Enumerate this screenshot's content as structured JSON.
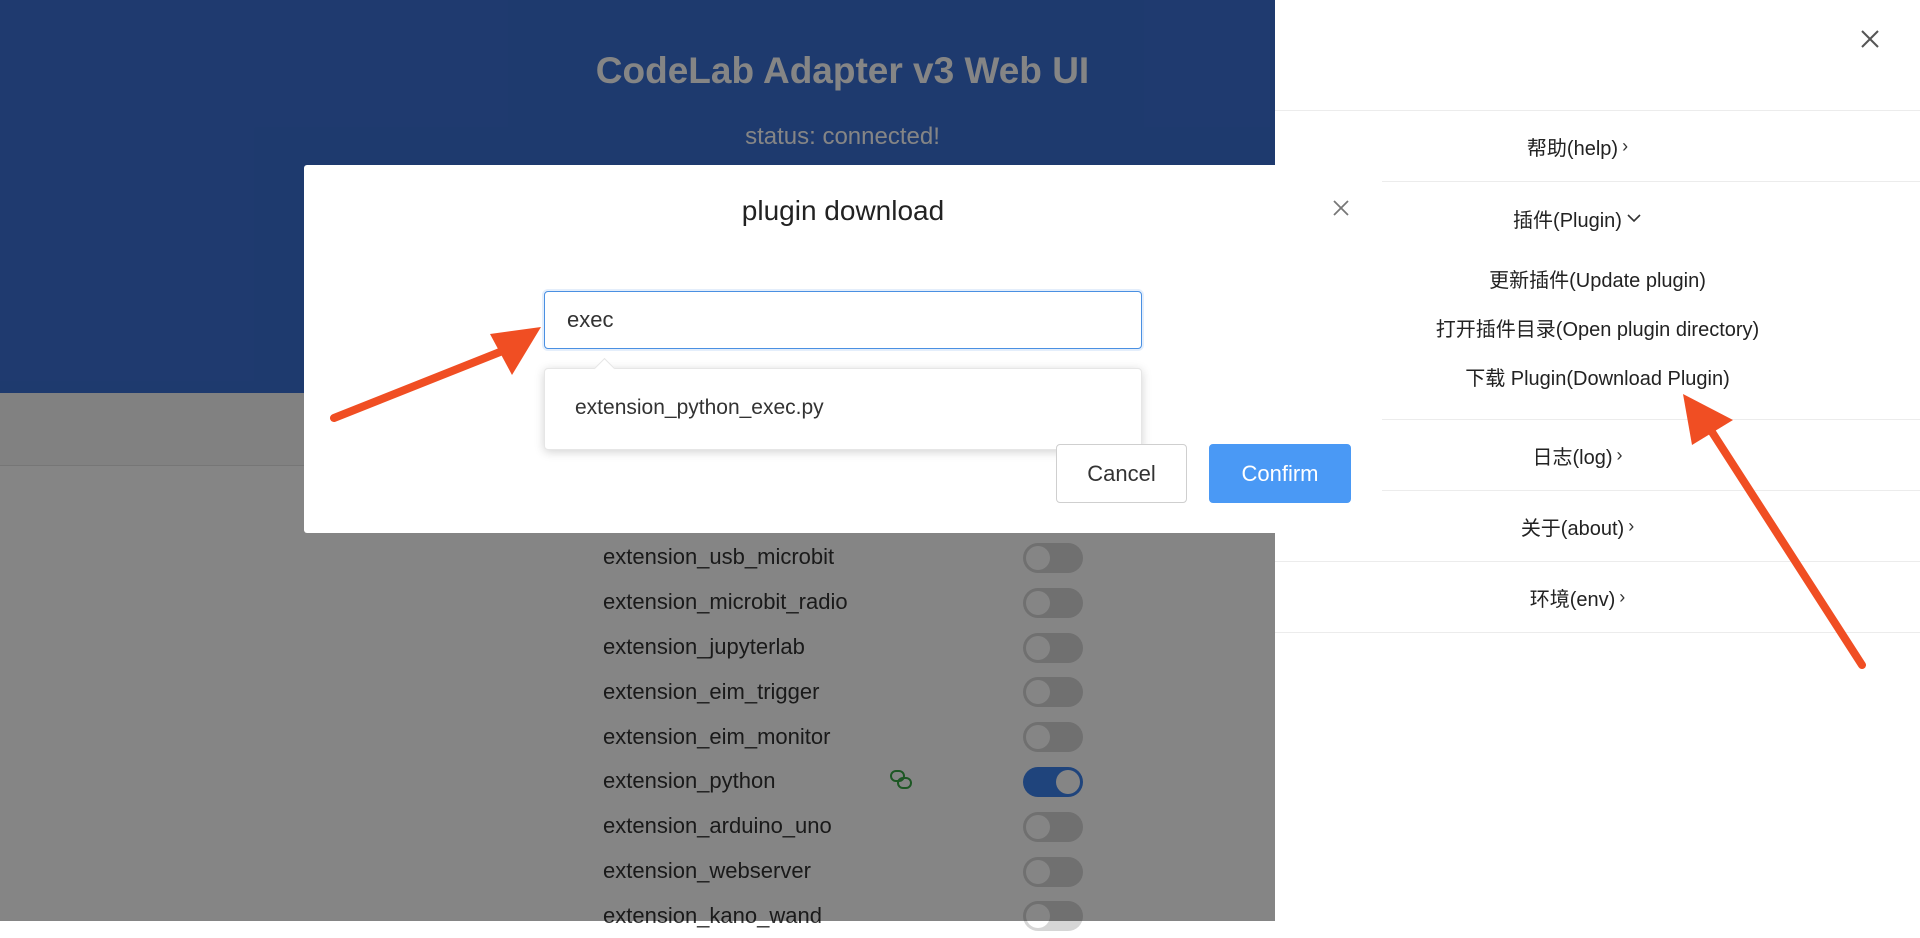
{
  "app": {
    "title": "CodeLab Adapter v3 Web UI",
    "status": "status: connected!"
  },
  "extensions": [
    {
      "name": "extension_usb_microbit",
      "enabled": false
    },
    {
      "name": "extension_microbit_radio",
      "enabled": false
    },
    {
      "name": "extension_jupyterlab",
      "enabled": false
    },
    {
      "name": "extension_eim_trigger",
      "enabled": false
    },
    {
      "name": "extension_eim_monitor",
      "enabled": false
    },
    {
      "name": "extension_python",
      "enabled": true
    },
    {
      "name": "extension_arduino_uno",
      "enabled": false
    },
    {
      "name": "extension_webserver",
      "enabled": false
    },
    {
      "name": "extension_kano_wand",
      "enabled": false
    }
  ],
  "drawer": {
    "menu": {
      "help": "帮助(help)",
      "plugin": "插件(Plugin)",
      "plugin_items": {
        "update": "更新插件(Update plugin)",
        "open_dir": "打开插件目录(Open plugin directory)",
        "download": "下载 Plugin(Download Plugin)"
      },
      "log": "日志(log)",
      "about": "关于(about)",
      "env": "环境(env)"
    }
  },
  "modal": {
    "title": "plugin download",
    "input_value": "exec",
    "suggestion": "extension_python_exec.py",
    "cancel_label": "Cancel",
    "confirm_label": "Confirm"
  },
  "colors": {
    "header_bg": "#3b6fd4",
    "accent": "#4a99f5",
    "annotation_arrow": "#f04e23"
  },
  "icons": {
    "close": "close-icon",
    "chevron_right": "chevron-right-icon",
    "chevron_down": "chevron-down-icon",
    "link": "link-icon"
  }
}
